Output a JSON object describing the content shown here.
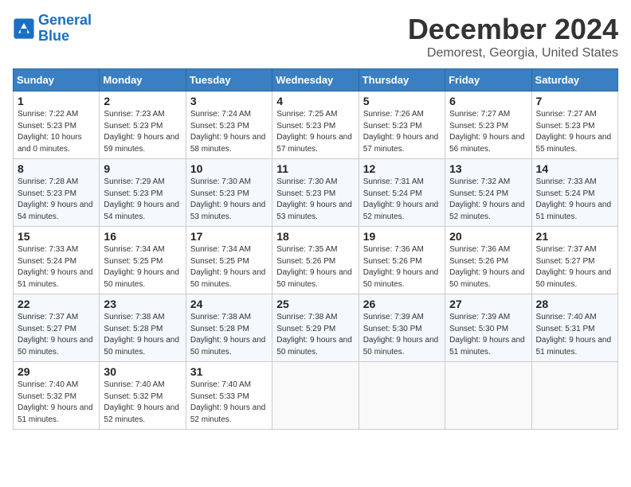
{
  "logo": {
    "line1": "General",
    "line2": "Blue"
  },
  "title": "December 2024",
  "location": "Demorest, Georgia, United States",
  "headers": [
    "Sunday",
    "Monday",
    "Tuesday",
    "Wednesday",
    "Thursday",
    "Friday",
    "Saturday"
  ],
  "weeks": [
    [
      {
        "day": "1",
        "sunrise": "7:22 AM",
        "sunset": "5:23 PM",
        "daylight": "10 hours and 0 minutes."
      },
      {
        "day": "2",
        "sunrise": "7:23 AM",
        "sunset": "5:23 PM",
        "daylight": "9 hours and 59 minutes."
      },
      {
        "day": "3",
        "sunrise": "7:24 AM",
        "sunset": "5:23 PM",
        "daylight": "9 hours and 58 minutes."
      },
      {
        "day": "4",
        "sunrise": "7:25 AM",
        "sunset": "5:23 PM",
        "daylight": "9 hours and 57 minutes."
      },
      {
        "day": "5",
        "sunrise": "7:26 AM",
        "sunset": "5:23 PM",
        "daylight": "9 hours and 57 minutes."
      },
      {
        "day": "6",
        "sunrise": "7:27 AM",
        "sunset": "5:23 PM",
        "daylight": "9 hours and 56 minutes."
      },
      {
        "day": "7",
        "sunrise": "7:27 AM",
        "sunset": "5:23 PM",
        "daylight": "9 hours and 55 minutes."
      }
    ],
    [
      {
        "day": "8",
        "sunrise": "7:28 AM",
        "sunset": "5:23 PM",
        "daylight": "9 hours and 54 minutes."
      },
      {
        "day": "9",
        "sunrise": "7:29 AM",
        "sunset": "5:23 PM",
        "daylight": "9 hours and 54 minutes."
      },
      {
        "day": "10",
        "sunrise": "7:30 AM",
        "sunset": "5:23 PM",
        "daylight": "9 hours and 53 minutes."
      },
      {
        "day": "11",
        "sunrise": "7:30 AM",
        "sunset": "5:23 PM",
        "daylight": "9 hours and 53 minutes."
      },
      {
        "day": "12",
        "sunrise": "7:31 AM",
        "sunset": "5:24 PM",
        "daylight": "9 hours and 52 minutes."
      },
      {
        "day": "13",
        "sunrise": "7:32 AM",
        "sunset": "5:24 PM",
        "daylight": "9 hours and 52 minutes."
      },
      {
        "day": "14",
        "sunrise": "7:33 AM",
        "sunset": "5:24 PM",
        "daylight": "9 hours and 51 minutes."
      }
    ],
    [
      {
        "day": "15",
        "sunrise": "7:33 AM",
        "sunset": "5:24 PM",
        "daylight": "9 hours and 51 minutes."
      },
      {
        "day": "16",
        "sunrise": "7:34 AM",
        "sunset": "5:25 PM",
        "daylight": "9 hours and 50 minutes."
      },
      {
        "day": "17",
        "sunrise": "7:34 AM",
        "sunset": "5:25 PM",
        "daylight": "9 hours and 50 minutes."
      },
      {
        "day": "18",
        "sunrise": "7:35 AM",
        "sunset": "5:26 PM",
        "daylight": "9 hours and 50 minutes."
      },
      {
        "day": "19",
        "sunrise": "7:36 AM",
        "sunset": "5:26 PM",
        "daylight": "9 hours and 50 minutes."
      },
      {
        "day": "20",
        "sunrise": "7:36 AM",
        "sunset": "5:26 PM",
        "daylight": "9 hours and 50 minutes."
      },
      {
        "day": "21",
        "sunrise": "7:37 AM",
        "sunset": "5:27 PM",
        "daylight": "9 hours and 50 minutes."
      }
    ],
    [
      {
        "day": "22",
        "sunrise": "7:37 AM",
        "sunset": "5:27 PM",
        "daylight": "9 hours and 50 minutes."
      },
      {
        "day": "23",
        "sunrise": "7:38 AM",
        "sunset": "5:28 PM",
        "daylight": "9 hours and 50 minutes."
      },
      {
        "day": "24",
        "sunrise": "7:38 AM",
        "sunset": "5:28 PM",
        "daylight": "9 hours and 50 minutes."
      },
      {
        "day": "25",
        "sunrise": "7:38 AM",
        "sunset": "5:29 PM",
        "daylight": "9 hours and 50 minutes."
      },
      {
        "day": "26",
        "sunrise": "7:39 AM",
        "sunset": "5:30 PM",
        "daylight": "9 hours and 50 minutes."
      },
      {
        "day": "27",
        "sunrise": "7:39 AM",
        "sunset": "5:30 PM",
        "daylight": "9 hours and 51 minutes."
      },
      {
        "day": "28",
        "sunrise": "7:40 AM",
        "sunset": "5:31 PM",
        "daylight": "9 hours and 51 minutes."
      }
    ],
    [
      {
        "day": "29",
        "sunrise": "7:40 AM",
        "sunset": "5:32 PM",
        "daylight": "9 hours and 51 minutes."
      },
      {
        "day": "30",
        "sunrise": "7:40 AM",
        "sunset": "5:32 PM",
        "daylight": "9 hours and 52 minutes."
      },
      {
        "day": "31",
        "sunrise": "7:40 AM",
        "sunset": "5:33 PM",
        "daylight": "9 hours and 52 minutes."
      },
      null,
      null,
      null,
      null
    ]
  ]
}
